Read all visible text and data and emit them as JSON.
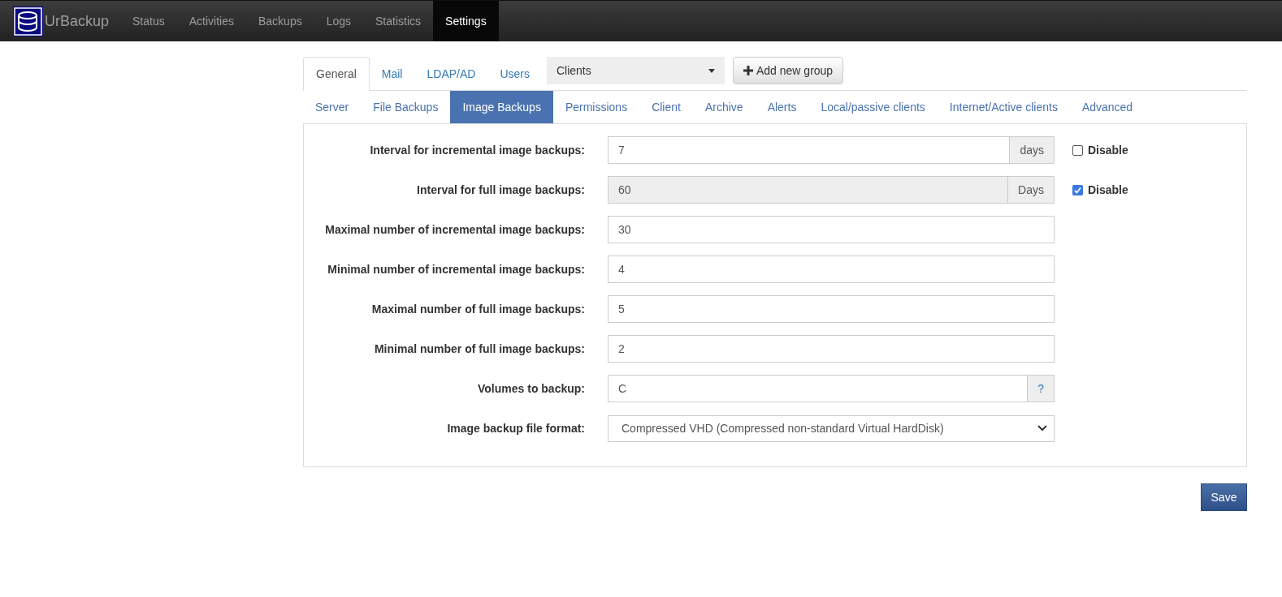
{
  "navbar": {
    "brand": "UrBackup",
    "items": [
      {
        "label": "Status",
        "selected": false
      },
      {
        "label": "Activities",
        "selected": false
      },
      {
        "label": "Backups",
        "selected": false
      },
      {
        "label": "Logs",
        "selected": false
      },
      {
        "label": "Statistics",
        "selected": false
      },
      {
        "label": "Settings",
        "selected": true
      }
    ]
  },
  "top_tabs": [
    {
      "label": "General",
      "selected": true
    },
    {
      "label": "Mail",
      "selected": false
    },
    {
      "label": "LDAP/AD",
      "selected": false
    },
    {
      "label": "Users",
      "selected": false
    }
  ],
  "group_select": {
    "value": "Clients"
  },
  "add_group_button": {
    "label": "Add new group"
  },
  "sub_tabs": [
    {
      "label": "Server",
      "selected": false
    },
    {
      "label": "File Backups",
      "selected": false
    },
    {
      "label": "Image Backups",
      "selected": true
    },
    {
      "label": "Permissions",
      "selected": false
    },
    {
      "label": "Client",
      "selected": false
    },
    {
      "label": "Archive",
      "selected": false
    },
    {
      "label": "Alerts",
      "selected": false
    },
    {
      "label": "Local/passive clients",
      "selected": false
    },
    {
      "label": "Internet/Active clients",
      "selected": false
    },
    {
      "label": "Advanced",
      "selected": false
    }
  ],
  "fields": [
    {
      "kind": "addon",
      "label": "Interval for incremental image backups:",
      "value": "7",
      "addon": "days",
      "disable": {
        "label": "Disable",
        "checked": false
      }
    },
    {
      "kind": "addon",
      "label": "Interval for full image backups:",
      "value": "60",
      "addon": "Days",
      "disable": {
        "label": "Disable",
        "checked": true
      }
    },
    {
      "kind": "plain",
      "label": "Maximal number of incremental image backups:",
      "value": "30"
    },
    {
      "kind": "plain",
      "label": "Minimal number of incremental image backups:",
      "value": "4"
    },
    {
      "kind": "plain",
      "label": "Maximal number of full image backups:",
      "value": "5"
    },
    {
      "kind": "plain",
      "label": "Minimal number of full image backups:",
      "value": "2"
    },
    {
      "kind": "help",
      "label": "Volumes to backup:",
      "value": "C",
      "addon": "?"
    },
    {
      "kind": "select",
      "label": "Image backup file format:",
      "value": "Compressed VHD (Compressed non-standard Virtual HardDisk)"
    }
  ],
  "save_button": {
    "label": "Save"
  }
}
